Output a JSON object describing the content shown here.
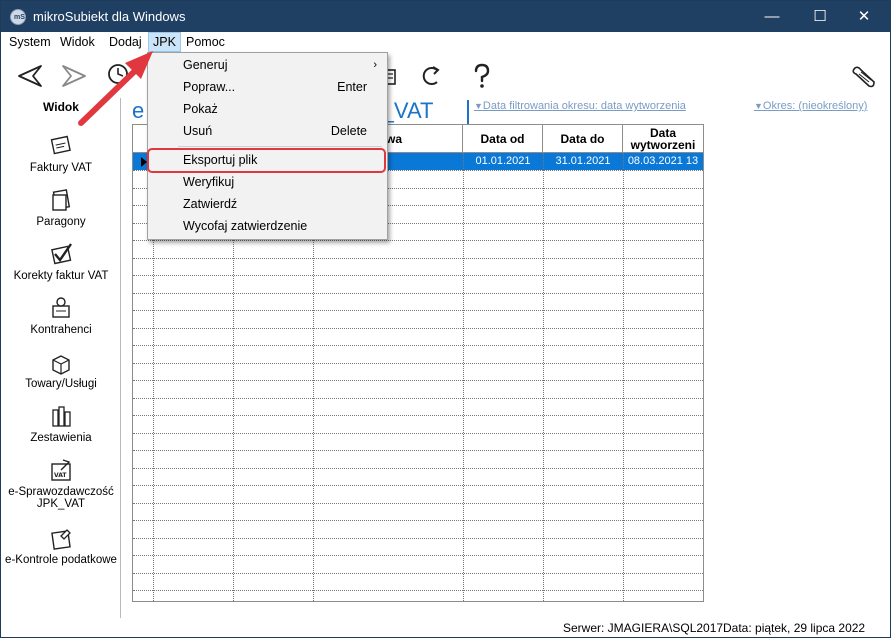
{
  "window": {
    "title": "mikroSubiekt dla Windows",
    "icon_text": "mS",
    "minimize": "—",
    "maximize": "☐",
    "close": "✕"
  },
  "menubar": {
    "items": [
      "System",
      "Widok",
      "Dodaj",
      "JPK",
      "Pomoc"
    ],
    "active": "JPK"
  },
  "jpk_menu": {
    "items": [
      {
        "label": "Generuj",
        "shortcut": "",
        "submenu": true
      },
      {
        "label": "Popraw...",
        "shortcut": "Enter"
      },
      {
        "label": "Pokaż",
        "shortcut": ""
      },
      {
        "label": "Usuń",
        "shortcut": "Delete"
      },
      {
        "label": "Eksportuj plik",
        "shortcut": "",
        "highlighted": true
      },
      {
        "label": "Weryfikuj",
        "shortcut": ""
      },
      {
        "label": "Zatwierdź",
        "shortcut": ""
      },
      {
        "label": "Wycofaj zatwierdzenie",
        "shortcut": ""
      }
    ],
    "submenu_glyph": "›"
  },
  "sidebar": {
    "title": "Widok",
    "items": [
      {
        "label": "Faktury VAT",
        "icon": "invoice-icon"
      },
      {
        "label": "Paragony",
        "icon": "receipt-icon"
      },
      {
        "label": "Korekty faktur VAT",
        "icon": "invoice-correction-icon"
      },
      {
        "label": "Kontrahenci",
        "icon": "contractors-icon"
      },
      {
        "label": "Towary/Usługi",
        "icon": "goods-icon"
      },
      {
        "label": "Zestawienia",
        "icon": "reports-icon"
      },
      {
        "label": "e-Sprawozdawczość JPK_VAT",
        "icon": "jpk-vat-icon"
      },
      {
        "label": "e-Kontrole podatkowe",
        "icon": "tax-control-icon"
      }
    ]
  },
  "content": {
    "heading_left": "e",
    "heading_right": "K_VAT",
    "filter_date": "Data filtrowania okresu: data wytworzenia",
    "filter_period": "Okres: (nieokreślony)"
  },
  "table": {
    "header_partial": "wa",
    "columns": [
      "Data od",
      "Data do",
      "Data wytworzeni"
    ],
    "selected_row": {
      "data_od": "01.01.2021",
      "data_do": "31.01.2021",
      "data_wytworzenia": "08.03.2021 13"
    }
  },
  "statusbar": {
    "server": "Serwer: JMAGIERA\\SQL2017",
    "date": "Data: piątek, 29 lipca 2022"
  },
  "colors": {
    "titlebar": "#1f3f63",
    "selection": "#0a78d7",
    "heading": "#1b74c5",
    "annotation": "#e0383e"
  }
}
